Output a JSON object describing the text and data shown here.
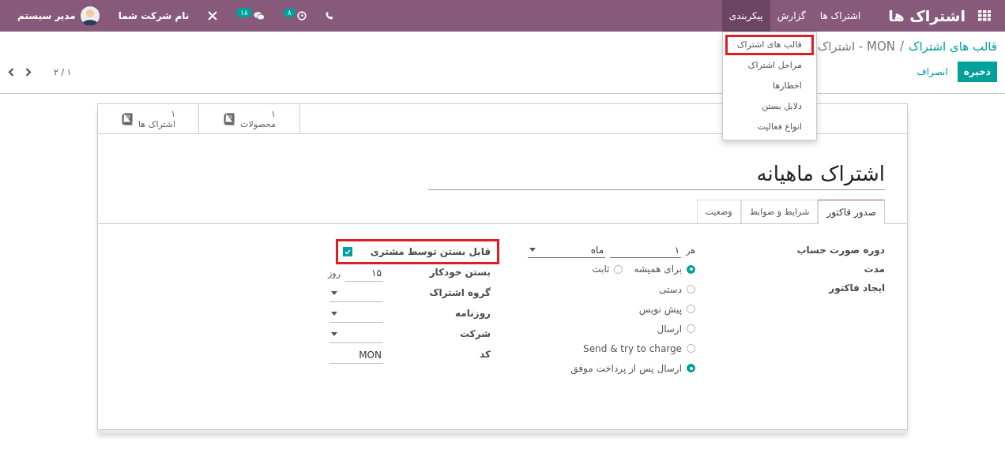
{
  "navbar": {
    "app_title": "اشتراک ها",
    "menus": [
      {
        "label": "اشتراک ها",
        "selected": false
      },
      {
        "label": "گزارش",
        "selected": false
      },
      {
        "label": "پیکربندی",
        "selected": true
      }
    ],
    "activity_badge": "۸",
    "messages_badge": "۱۸",
    "company": "نام شرکت شما",
    "user": "مدیر سیستم"
  },
  "dropdown": {
    "items": [
      {
        "label": "قالب های اشتراک",
        "highlighted": true
      },
      {
        "label": "مراحل اشتراک",
        "highlighted": false
      },
      {
        "label": "اخطارها",
        "highlighted": false
      },
      {
        "label": "دلایل بستن",
        "highlighted": false
      },
      {
        "label": "انواع فعالیت",
        "highlighted": false
      }
    ]
  },
  "breadcrumb": {
    "parent": "قالب های اشتراک",
    "separator": "/",
    "current": "MON - اشتراک"
  },
  "buttons": {
    "save": "ذخیره",
    "discard": "انصراف"
  },
  "pager": "۲ / ۱",
  "stat_buttons": [
    {
      "value": "۱",
      "label": "محصولات"
    },
    {
      "value": "۱",
      "label": "اشتراک ها"
    }
  ],
  "title": "اشتراک ماهیانه",
  "tabs": [
    {
      "label": "صدور فاکتور",
      "selected": true
    },
    {
      "label": "شرایط و ضوابط",
      "selected": false
    },
    {
      "label": "وضعیت",
      "selected": false
    }
  ],
  "billing_period": {
    "label": "دوره صورت حساب",
    "prefix": "هر",
    "value": "۱",
    "unit": "ماه"
  },
  "duration": {
    "label": "مدت",
    "options": [
      {
        "label": "برای همیشه",
        "selected": true
      },
      {
        "label": "ثابت",
        "selected": false
      }
    ]
  },
  "invoicing": {
    "label": "ایجاد فاکتور",
    "options": [
      {
        "label": "دستی",
        "selected": false
      },
      {
        "label": "پیش نویس",
        "selected": false
      },
      {
        "label": "ارسال",
        "selected": false
      },
      {
        "label": "Send & try to charge",
        "selected": false
      },
      {
        "label": "ارسال پس از پرداخت موفق",
        "selected": true
      }
    ]
  },
  "fields": [
    {
      "kind": "checkbox",
      "label": "قابل بستن توسط مشتری",
      "checked": true,
      "highlighted": true
    },
    {
      "kind": "number",
      "label": "بستن خودکار",
      "value": "۱۵",
      "unit": "روز"
    },
    {
      "kind": "select",
      "label": "گروه اشتراک"
    },
    {
      "kind": "select",
      "label": "روزنامه"
    },
    {
      "kind": "select",
      "label": "شرکت"
    },
    {
      "kind": "text",
      "label": "کد",
      "value": "MON"
    }
  ]
}
